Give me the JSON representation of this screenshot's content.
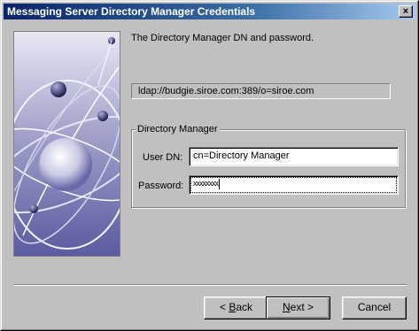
{
  "window": {
    "title": "Messaging Server Directory Manager Credentials"
  },
  "intro": "The Directory Manager DN and password.",
  "server": {
    "url": "ldap://budgie.siroe.com:389/o=siroe.com"
  },
  "group": {
    "label": "Directory Manager",
    "user_dn": {
      "label": "User DN:",
      "value": "cn=Directory Manager"
    },
    "password": {
      "label": "Password:",
      "value": "xxxxxxxx"
    }
  },
  "buttons": {
    "back": {
      "hotkey": "B",
      "rest": "ack",
      "prefix": "< "
    },
    "next": {
      "hotkey": "N",
      "rest": "ext",
      "suffix": " >"
    },
    "cancel": "Cancel"
  },
  "colors": {
    "title_start": "#0a246a",
    "title_end": "#a6caf0",
    "face": "#c0c0c0"
  }
}
